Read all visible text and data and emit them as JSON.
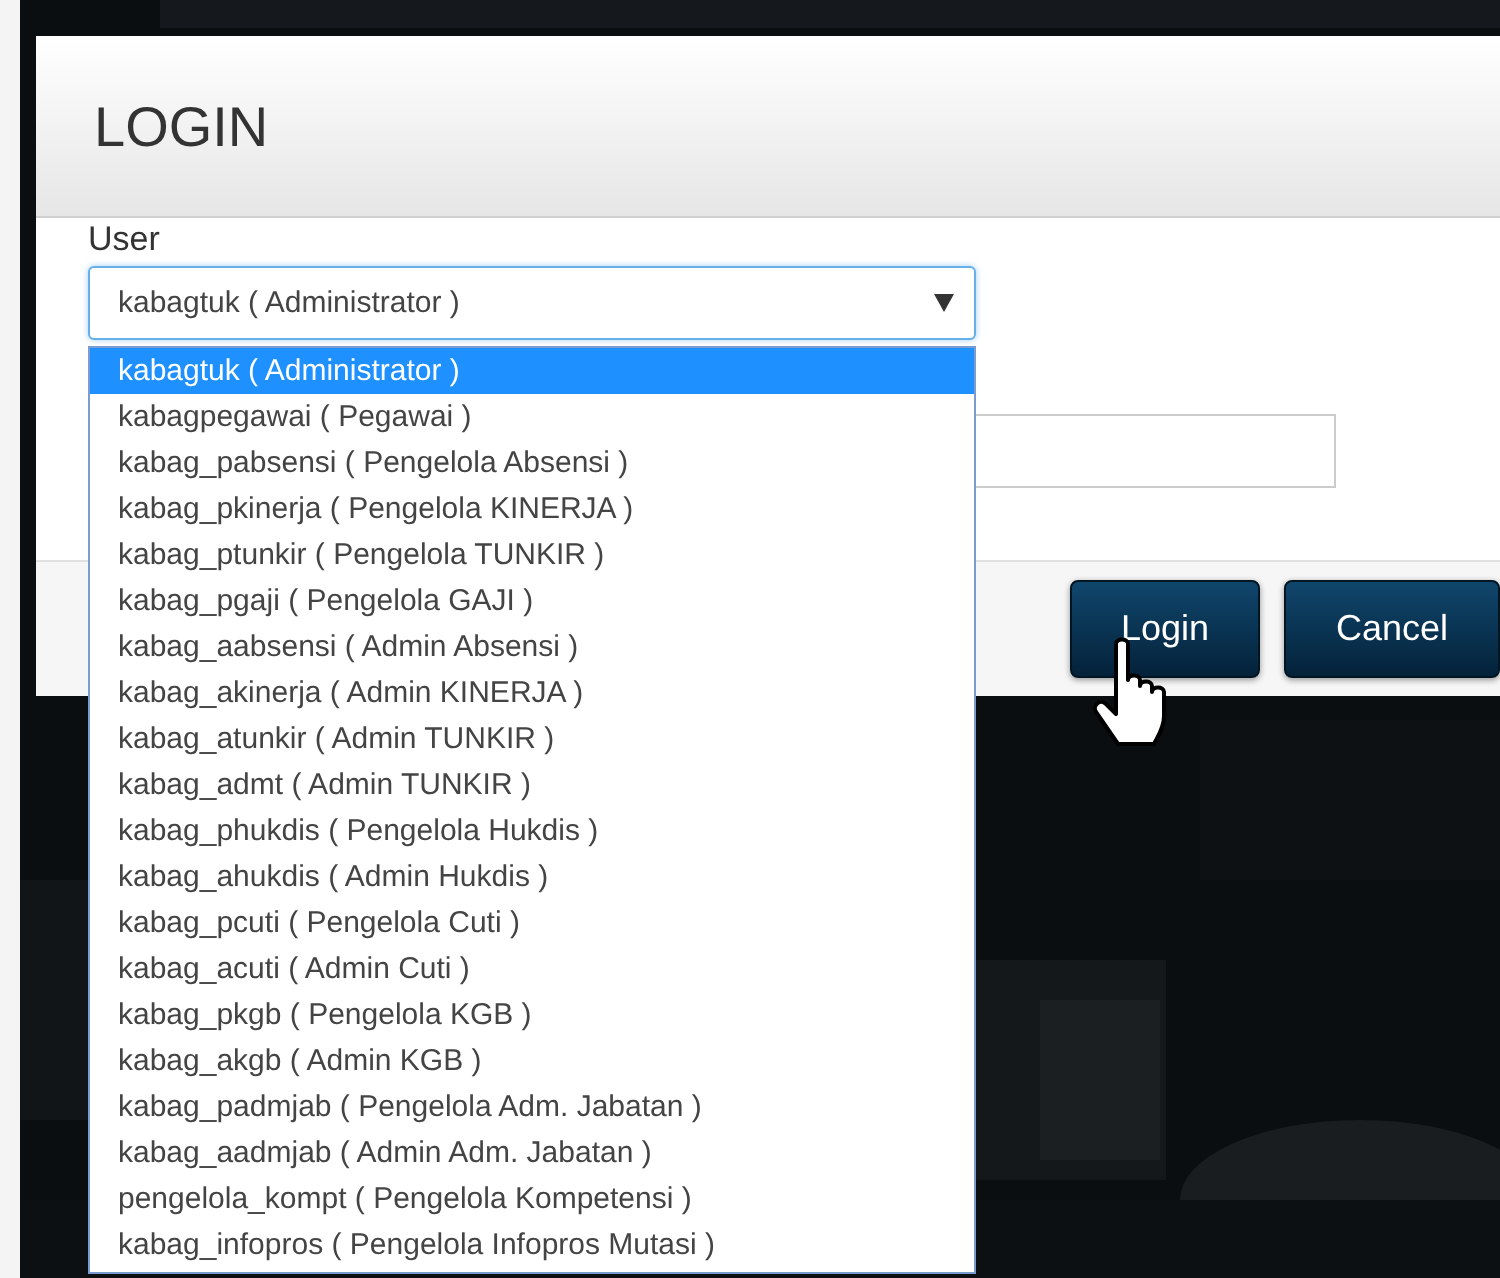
{
  "dialog": {
    "title": "LOGIN",
    "user_label": "User",
    "user_select": {
      "value": "kabagtuk ( Administrator )",
      "expanded": true,
      "options": [
        {
          "label": "kabagtuk ( Administrator )",
          "selected": true
        },
        {
          "label": "kabagpegawai ( Pegawai )",
          "selected": false
        },
        {
          "label": "kabag_pabsensi ( Pengelola Absensi )",
          "selected": false
        },
        {
          "label": "kabag_pkinerja ( Pengelola KINERJA )",
          "selected": false
        },
        {
          "label": "kabag_ptunkir ( Pengelola TUNKIR )",
          "selected": false
        },
        {
          "label": "kabag_pgaji ( Pengelola GAJI )",
          "selected": false
        },
        {
          "label": "kabag_aabsensi ( Admin Absensi )",
          "selected": false
        },
        {
          "label": "kabag_akinerja ( Admin KINERJA )",
          "selected": false
        },
        {
          "label": "kabag_atunkir ( Admin TUNKIR )",
          "selected": false
        },
        {
          "label": "kabag_admt ( Admin TUNKIR )",
          "selected": false
        },
        {
          "label": "kabag_phukdis ( Pengelola Hukdis )",
          "selected": false
        },
        {
          "label": "kabag_ahukdis ( Admin Hukdis )",
          "selected": false
        },
        {
          "label": "kabag_pcuti ( Pengelola Cuti )",
          "selected": false
        },
        {
          "label": "kabag_acuti ( Admin Cuti )",
          "selected": false
        },
        {
          "label": "kabag_pkgb ( Pengelola KGB )",
          "selected": false
        },
        {
          "label": "kabag_akgb ( Admin KGB )",
          "selected": false
        },
        {
          "label": "kabag_padmjab ( Pengelola Adm. Jabatan )",
          "selected": false
        },
        {
          "label": "kabag_aadmjab ( Admin Adm. Jabatan )",
          "selected": false
        },
        {
          "label": "pengelola_kompt ( Pengelola Kompetensi )",
          "selected": false
        },
        {
          "label": "kabag_infopros ( Pengelola Infopros Mutasi )",
          "selected": false
        }
      ]
    },
    "buttons": [
      {
        "label": "Login",
        "kind": "primary"
      },
      {
        "label": "Cancel",
        "kind": "secondary"
      }
    ]
  }
}
